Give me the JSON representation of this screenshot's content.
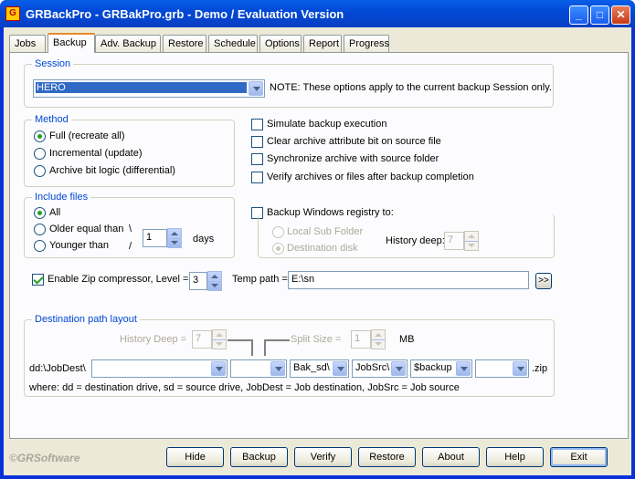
{
  "window": {
    "title": "GRBackPro - GRBakPro.grb - Demo / Evaluation Version",
    "icon": "gr-app-icon",
    "controls": [
      "minimize-icon",
      "maximize-icon",
      "close-icon"
    ]
  },
  "tabs": [
    "Jobs",
    "Backup",
    "Adv. Backup",
    "Restore",
    "Schedule",
    "Options",
    "Report",
    "Progress"
  ],
  "active_tab": "Backup",
  "session": {
    "legend": "Session",
    "value": "HERO",
    "note": "NOTE: These options apply to the current backup Session only."
  },
  "method": {
    "legend": "Method",
    "options": [
      "Full (recreate all)",
      "Incremental (update)",
      "Archive bit logic (differential)"
    ],
    "selected": "Full (recreate all)"
  },
  "options": {
    "simulate": "Simulate backup execution",
    "clear_archive": "Clear archive attribute bit on source file",
    "synchronize": "Synchronize archive with source folder",
    "verify": "Verify archives or files after backup completion"
  },
  "include": {
    "legend": "Include files",
    "all": "All",
    "older": "Older equal than",
    "younger": "Younger than",
    "days_value": "1",
    "days_label": "days",
    "slash1": "\\",
    "slash2": "/",
    "selected": "All"
  },
  "registry": {
    "label": "Backup Windows registry to:",
    "local": "Local Sub Folder",
    "destination": "Destination disk",
    "history_label": "History deep:",
    "history_value": "7",
    "selected": "Destination disk"
  },
  "zip": {
    "label": "Enable Zip compressor, Level =",
    "level": "3",
    "checked": true,
    "temp_label": "Temp path =",
    "temp_value": "E:\\sn",
    "browse": ">>"
  },
  "dest": {
    "legend": "Destination path layout",
    "history_label": "History Deep =",
    "history_value": "7",
    "split_label": "Split Size =",
    "split_value": "1",
    "split_unit": "MB",
    "prefix": "dd:\\JobDest\\",
    "combo1": "",
    "combo2": "",
    "combo3": "Bak_sd\\",
    "combo4": "JobSrc\\",
    "combo5": "$backup",
    "combo6": "",
    "suffix": ".zip",
    "help": "where: dd = destination drive, sd = source drive, JobDest = Job destination, JobSrc = Job source"
  },
  "footer": {
    "brand": "©GRSoftware",
    "buttons": [
      "Hide",
      "Backup",
      "Verify",
      "Restore",
      "About",
      "Help",
      "Exit"
    ]
  }
}
